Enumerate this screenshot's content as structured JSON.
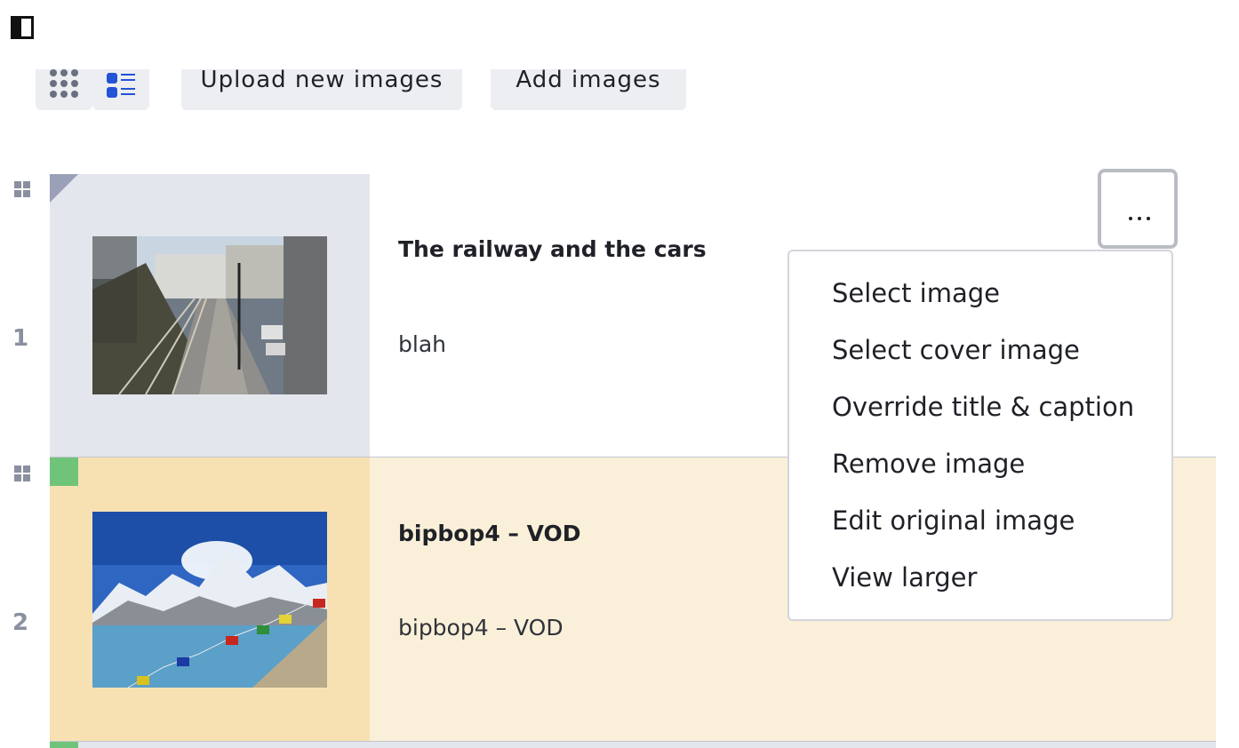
{
  "toolbar": {
    "grid_view_icon": "grid-icon",
    "list_view_icon": "list-icon",
    "upload_label": "Upload new images",
    "add_label": "Add images"
  },
  "rows": [
    {
      "number": "1",
      "title": "The railway and the cars",
      "caption": "blah"
    },
    {
      "number": "2",
      "title": "bipbop4 – VOD",
      "caption": "bipbop4 – VOD"
    }
  ],
  "menu": {
    "items": [
      "Select image",
      "Select cover image",
      "Override title & caption",
      "Remove image",
      "Edit original image",
      "View larger"
    ]
  },
  "colors": {
    "accent": "#2453d6",
    "row_highlight": "#faf0d9",
    "status_green": "#70c47a"
  }
}
